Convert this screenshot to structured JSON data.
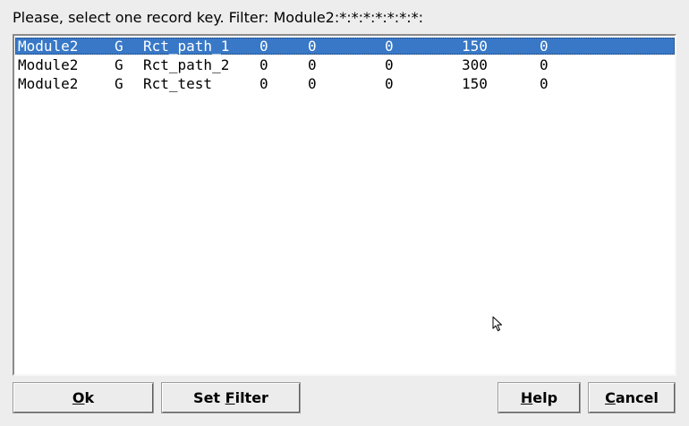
{
  "dialog": {
    "prompt": "Please, select one record key. Filter: Module2:*:*:*:*:*:*:*:"
  },
  "records": [
    {
      "c1": "Module2",
      "c2": "G",
      "c3": "Rct_path_1",
      "c4": "0",
      "c5": "0",
      "c6": "0",
      "c7": "150",
      "c8": "0",
      "selected": true
    },
    {
      "c1": "Module2",
      "c2": "G",
      "c3": "Rct_path_2",
      "c4": "0",
      "c5": "0",
      "c6": "0",
      "c7": "300",
      "c8": "0",
      "selected": false
    },
    {
      "c1": "Module2",
      "c2": "G",
      "c3": "Rct_test",
      "c4": "0",
      "c5": "0",
      "c6": "0",
      "c7": "150",
      "c8": "0",
      "selected": false
    }
  ],
  "buttons": {
    "ok": {
      "pre": "",
      "mn": "O",
      "post": "k"
    },
    "set_filter": {
      "pre": "Set ",
      "mn": "F",
      "post": "ilter"
    },
    "help": {
      "pre": "",
      "mn": "H",
      "post": "elp"
    },
    "cancel": {
      "pre": "",
      "mn": "C",
      "post": "ancel"
    }
  },
  "colors": {
    "selection": "#3878c7",
    "window_bg": "#ededed",
    "list_bg": "#ffffff"
  }
}
